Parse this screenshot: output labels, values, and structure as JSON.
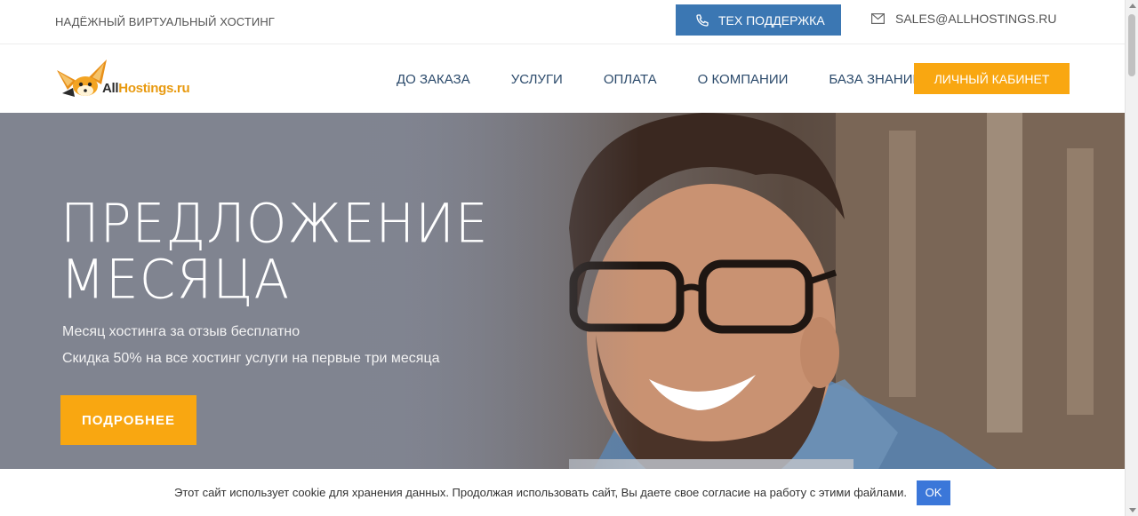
{
  "topbar": {
    "tagline": "НАДЁЖНЫЙ ВИРТУАЛЬНЫЙ ХОСТИНГ",
    "support_label": "ТЕХ ПОДДЕРЖКА",
    "email": "SALES@ALLHOSTINGS.RU",
    "support_icon": "phone-icon",
    "email_icon": "envelope-icon"
  },
  "header": {
    "logo": {
      "brand_prefix": "All",
      "brand_suffix": "Hostings.ru",
      "icon": "fox-logo-icon"
    },
    "nav": [
      {
        "label": "ДО ЗАКАЗА"
      },
      {
        "label": "УСЛУГИ"
      },
      {
        "label": "ОПЛАТА"
      },
      {
        "label": "О КОМПАНИИ"
      },
      {
        "label": "БАЗА ЗНАНИЙ"
      }
    ],
    "cabinet_label": "ЛИЧНЫЙ КАБИНЕТ"
  },
  "hero": {
    "title_line1": "ПРЕДЛОЖЕНИЕ",
    "title_line2": "МЕСЯЦА",
    "sub1": "Месяц хостинга за отзыв бесплатно",
    "sub2": "Скидка 50% на все хостинг услуги на первые три месяца",
    "button_label": "ПОДРОБНЕЕ"
  },
  "cookie": {
    "text": "Этот сайт использует cookie для хранения данных. Продолжая использовать сайт, Вы даете свое согласие на работу с этими файлами.",
    "ok_label": "OK"
  },
  "colors": {
    "accent_orange": "#f9a711",
    "accent_blue": "#3b77b3",
    "nav_text": "#2b4a6b",
    "ok_blue": "#3b77d9"
  }
}
